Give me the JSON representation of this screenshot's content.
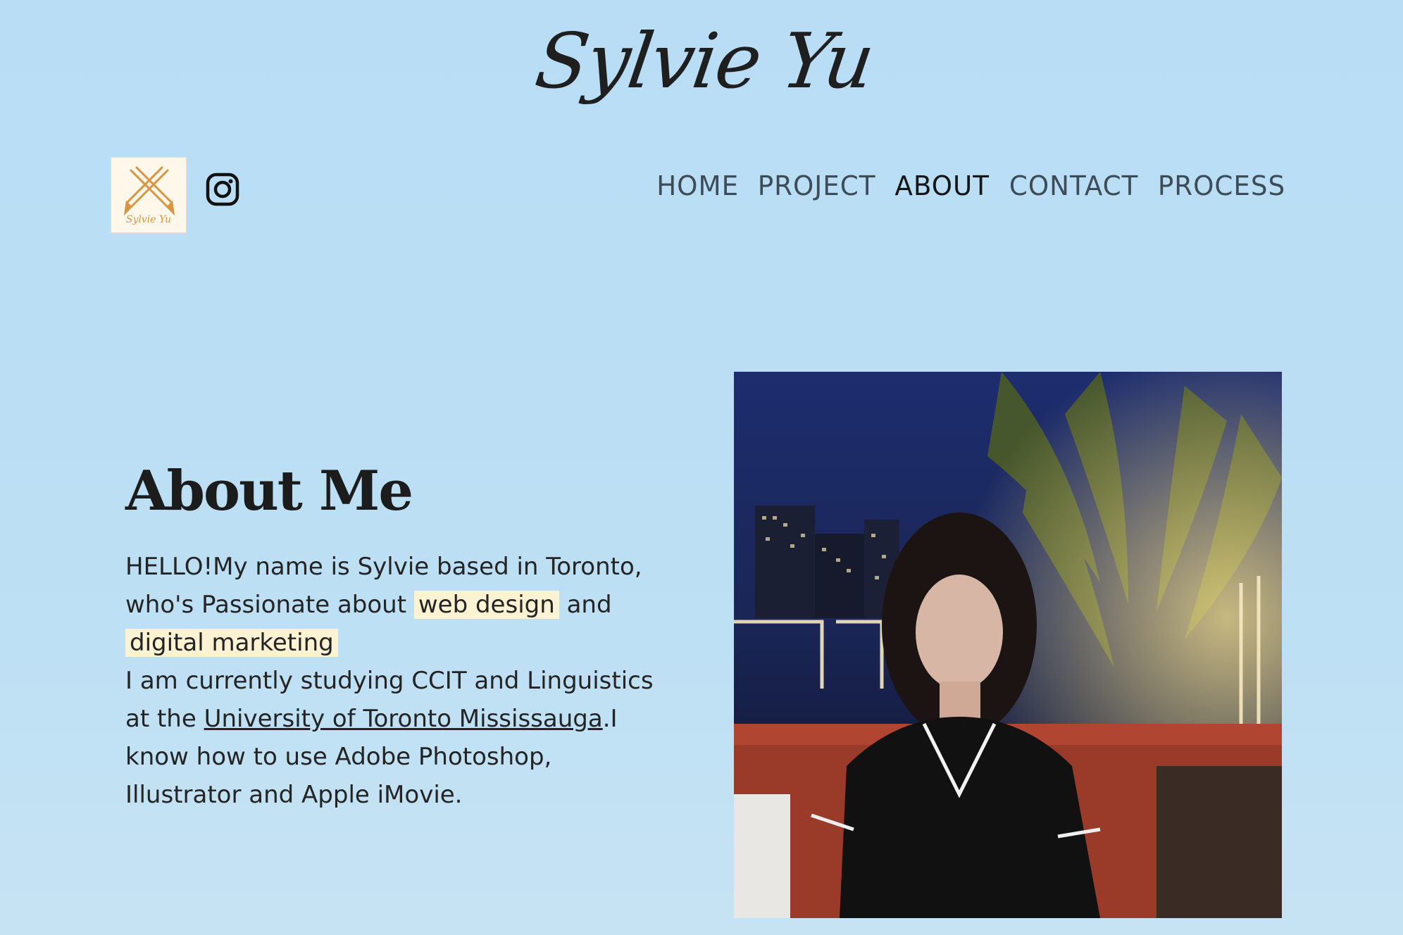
{
  "header": {
    "site_title": "Sylvie Yu",
    "logo": {
      "label": "Sylvie Yu",
      "icon": "crossed-pencils-icon"
    },
    "social": {
      "instagram_icon": "instagram-icon"
    }
  },
  "nav": {
    "items": [
      {
        "label": "HOME",
        "active": false
      },
      {
        "label": "PROJECT",
        "active": false
      },
      {
        "label": "ABOUT",
        "active": true
      },
      {
        "label": "CONTACT",
        "active": false
      },
      {
        "label": "PROCESS",
        "active": false
      }
    ]
  },
  "about": {
    "title": "About Me",
    "intro_part1": "HELLO!My name is Sylvie based in Toronto, who's Passionate about ",
    "highlight1": "web design",
    "between": " and ",
    "highlight2": "digital marketing",
    "studying_prefix": "I am currently studying CCIT and Linguistics at the ",
    "university_link": "University of Toronto Mississauga",
    "skills": ".I know how to use Adobe Photoshop, Illustrator and Apple iMovie."
  },
  "photo": {
    "alt": "portrait-photo"
  },
  "colors": {
    "background": "#b8ddf5",
    "highlight": "#fdf2d2",
    "logo_accent": "#d99542"
  }
}
